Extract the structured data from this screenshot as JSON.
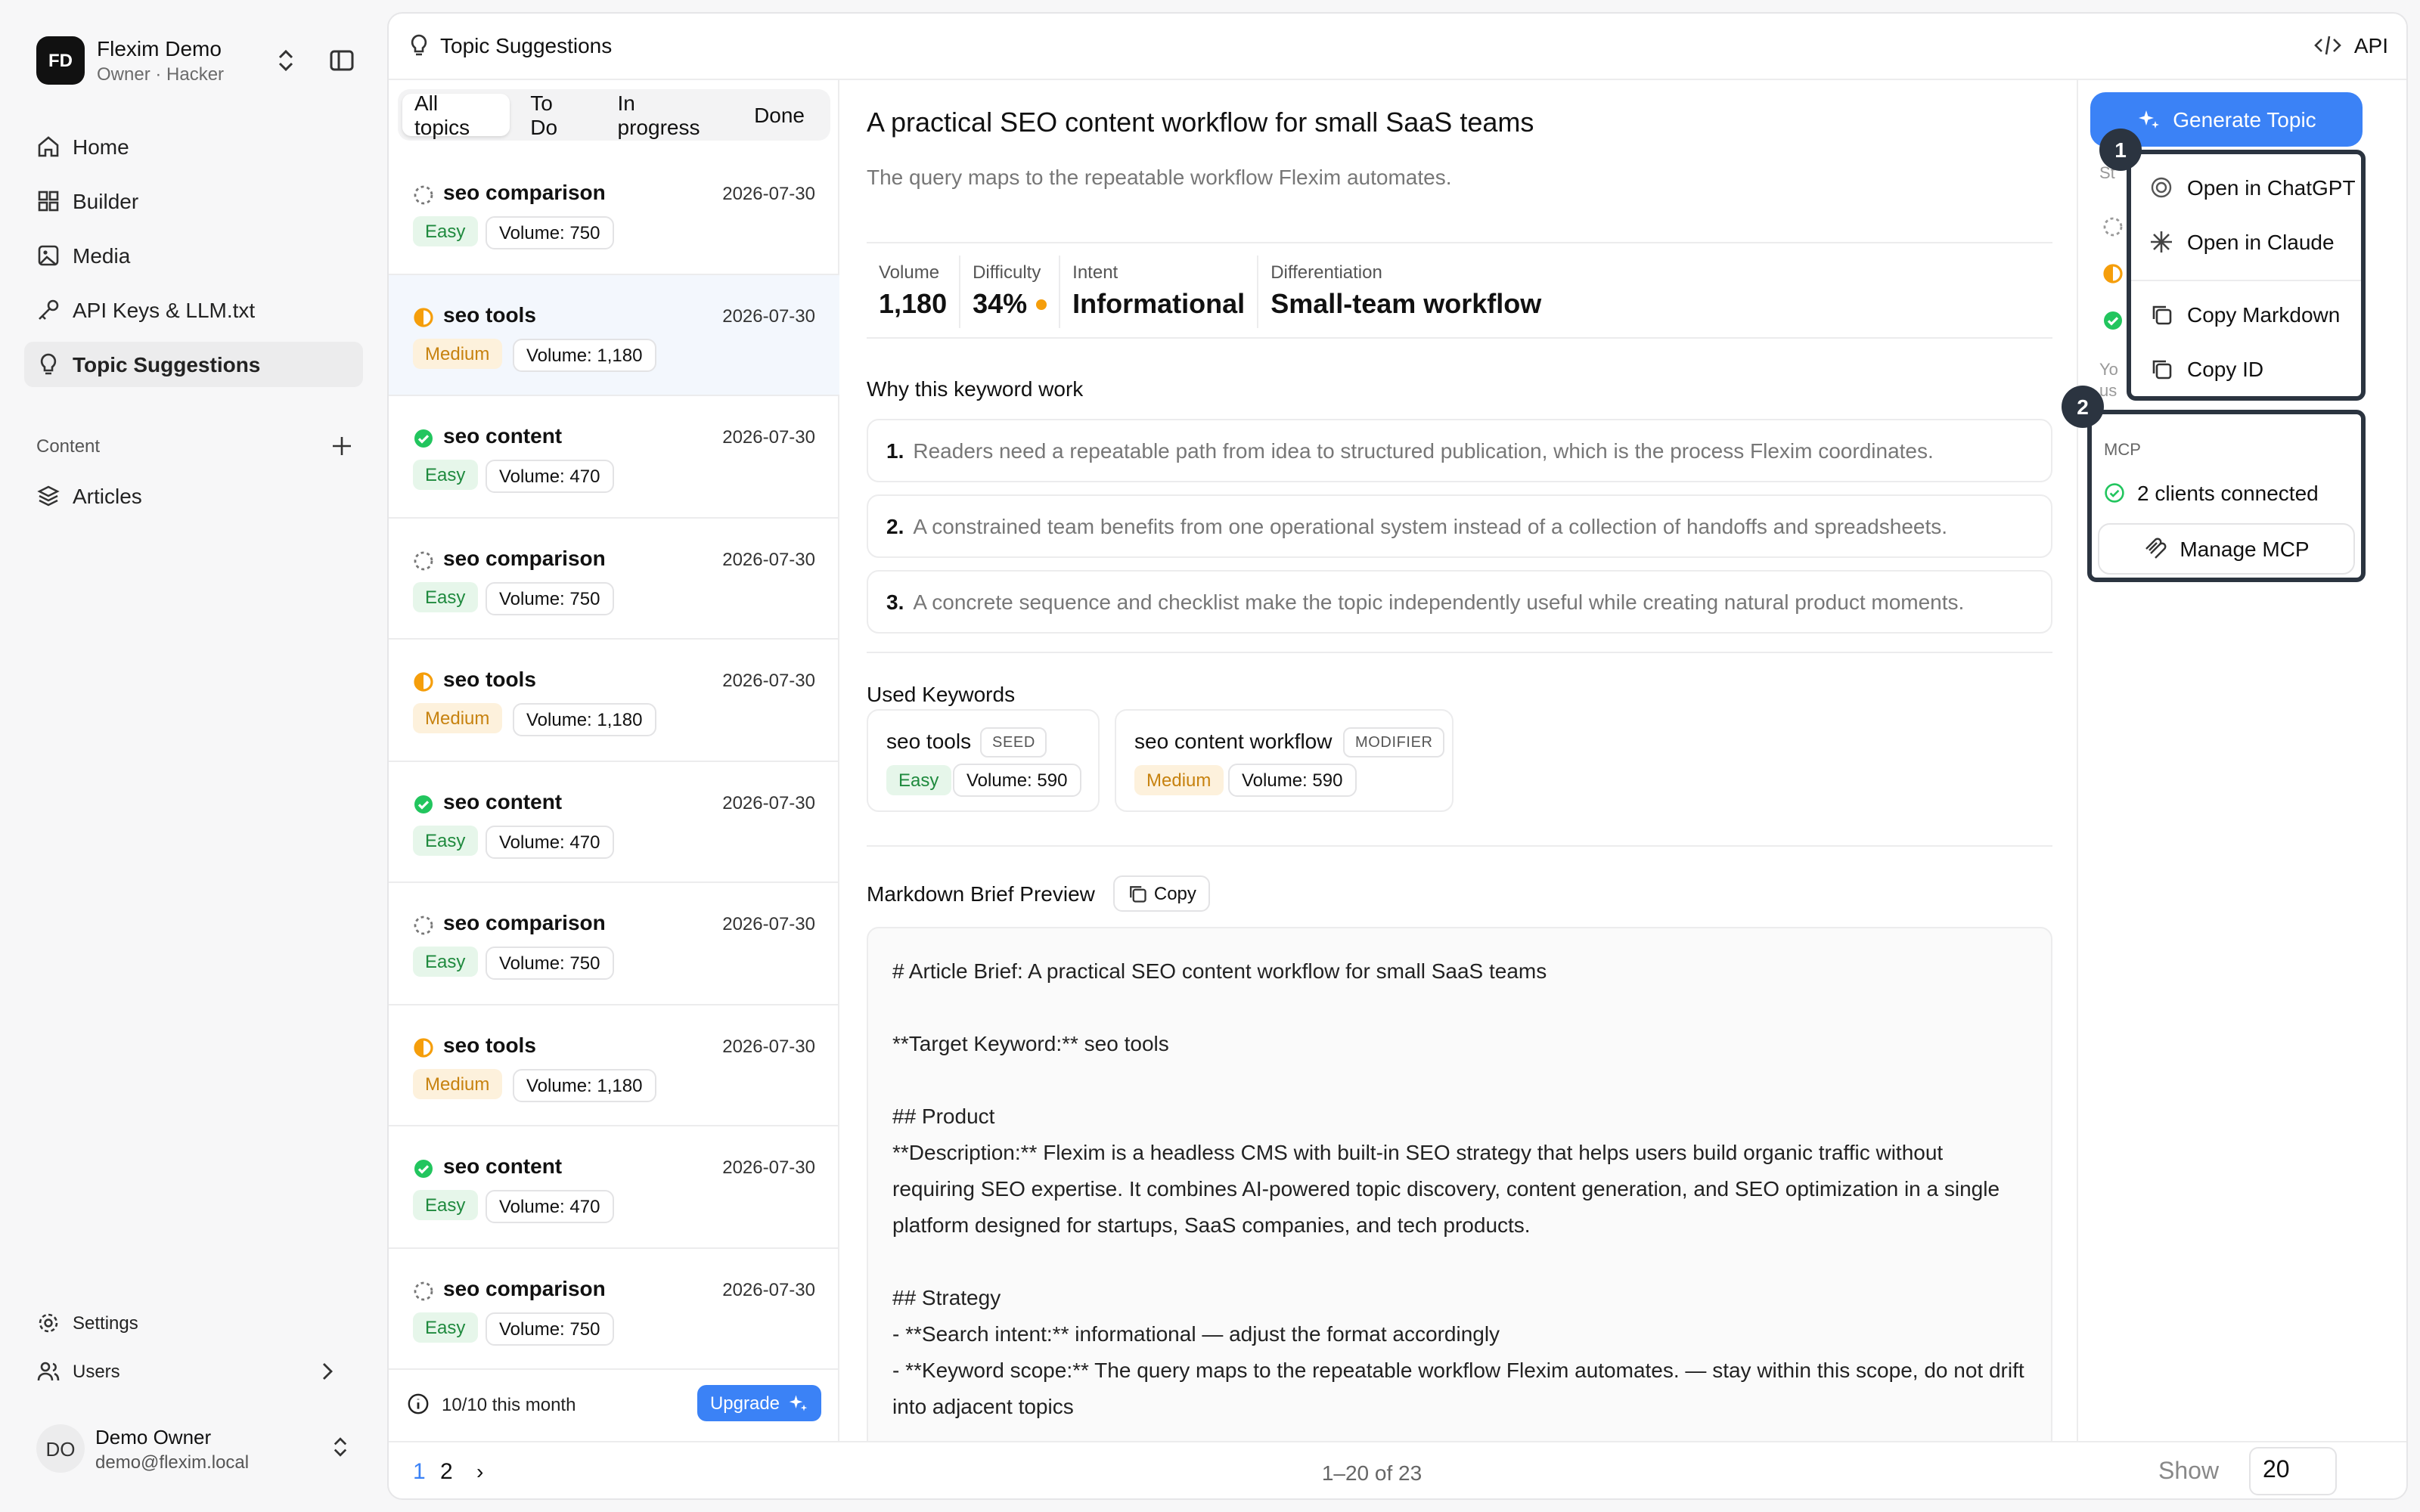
{
  "workspace": {
    "initials": "FD",
    "name": "Flexim Demo",
    "role": "Owner · Hacker"
  },
  "nav": [
    {
      "label": "Home",
      "icon": "home-icon"
    },
    {
      "label": "Builder",
      "icon": "grid-icon"
    },
    {
      "label": "Media",
      "icon": "image-icon"
    },
    {
      "label": "API Keys & LLM.txt",
      "icon": "key-icon"
    },
    {
      "label": "Topic Suggestions",
      "icon": "lightbulb-icon",
      "active": true
    }
  ],
  "content_section": {
    "label": "Content",
    "items": [
      {
        "label": "Articles",
        "icon": "layers-icon"
      }
    ]
  },
  "bottom_nav": {
    "settings": "Settings",
    "users": "Users"
  },
  "user": {
    "initials": "DO",
    "name": "Demo Owner",
    "email": "demo@flexim.local"
  },
  "header": {
    "title": "Topic Suggestions",
    "api": "API"
  },
  "tabs": [
    "All topics",
    "To Do",
    "In progress",
    "Done"
  ],
  "topics": [
    {
      "title": "seo comparison",
      "date": "2026-07-30",
      "difficulty": "Easy",
      "volume": "Volume: 750",
      "status": "todo"
    },
    {
      "title": "seo tools",
      "date": "2026-07-30",
      "difficulty": "Medium",
      "volume": "Volume: 1,180",
      "status": "progress",
      "selected": true
    },
    {
      "title": "seo content",
      "date": "2026-07-30",
      "difficulty": "Easy",
      "volume": "Volume: 470",
      "status": "done"
    },
    {
      "title": "seo comparison",
      "date": "2026-07-30",
      "difficulty": "Easy",
      "volume": "Volume: 750",
      "status": "todo"
    },
    {
      "title": "seo tools",
      "date": "2026-07-30",
      "difficulty": "Medium",
      "volume": "Volume: 1,180",
      "status": "progress"
    },
    {
      "title": "seo content",
      "date": "2026-07-30",
      "difficulty": "Easy",
      "volume": "Volume: 470",
      "status": "done"
    },
    {
      "title": "seo comparison",
      "date": "2026-07-30",
      "difficulty": "Easy",
      "volume": "Volume: 750",
      "status": "todo"
    },
    {
      "title": "seo tools",
      "date": "2026-07-30",
      "difficulty": "Medium",
      "volume": "Volume: 1,180",
      "status": "progress"
    },
    {
      "title": "seo content",
      "date": "2026-07-30",
      "difficulty": "Easy",
      "volume": "Volume: 470",
      "status": "done"
    },
    {
      "title": "seo comparison",
      "date": "2026-07-30",
      "difficulty": "Easy",
      "volume": "Volume: 750",
      "status": "todo"
    }
  ],
  "list_footer": {
    "quota": "10/10 this month",
    "upgrade": "Upgrade"
  },
  "detail": {
    "title": "A practical SEO content workflow for small SaaS teams",
    "subtitle": "The query maps to the repeatable workflow Flexim automates.",
    "metrics": [
      {
        "label": "Volume",
        "value": "1,180"
      },
      {
        "label": "Difficulty",
        "value": "34%"
      },
      {
        "label": "Intent",
        "value": "Informational"
      },
      {
        "label": "Differentiation",
        "value": "Small-team workflow"
      }
    ],
    "why_heading": "Why this keyword work",
    "reasons": [
      {
        "num": "1.",
        "text": "Readers need a repeatable path from idea to structured publication, which is the process Flexim coordinates."
      },
      {
        "num": "2.",
        "text": "A constrained team benefits from one operational system instead of a collection of handoffs and spreadsheets."
      },
      {
        "num": "3.",
        "text": "A concrete sequence and checklist make the topic independently useful while creating natural product moments."
      }
    ],
    "keywords_heading": "Used Keywords",
    "keywords": [
      {
        "name": "seo tools",
        "tag": "SEED",
        "difficulty": "Easy",
        "volume": "Volume: 590"
      },
      {
        "name": "seo content workflow",
        "tag": "MODIFIER",
        "difficulty": "Medium",
        "volume": "Volume: 590"
      }
    ],
    "md_heading": "Markdown Brief Preview",
    "copy": "Copy",
    "markdown": "# Article Brief: A practical SEO content workflow for small SaaS teams\n\n**Target Keyword:** seo tools\n\n## Product\n**Description:** Flexim is a headless CMS with built-in SEO strategy that helps users build organic traffic without requiring SEO expertise. It combines AI-powered topic discovery, content generation, and SEO optimization in a single platform designed for startups, SaaS companies, and tech products.\n\n## Strategy\n- **Search intent:** informational — adjust the format accordingly\n- **Keyword scope:** The query maps to the repeatable workflow Flexim automates. — stay within this scope, do not drift into adjacent topics"
  },
  "right": {
    "generate": "Generate Topic",
    "ghost_texts": [
      "St",
      "Yo",
      "us"
    ],
    "menu": [
      "Open in ChatGPT",
      "Open in Claude",
      "Copy Markdown",
      "Copy ID"
    ],
    "mcp_label": "MCP",
    "mcp_status": "2 clients connected",
    "mcp_button": "Manage MCP",
    "steps": [
      "1",
      "2"
    ]
  },
  "pager": {
    "pages": [
      "1",
      "2"
    ],
    "next": "›",
    "range": "1–20 of 23",
    "show": "Show",
    "page_size": "20"
  },
  "colors": {
    "accent": "#3b82f6",
    "easy": "#1f8a3e",
    "medium": "#c7820f",
    "done": "#22c55e",
    "progress": "#f59e0b"
  }
}
